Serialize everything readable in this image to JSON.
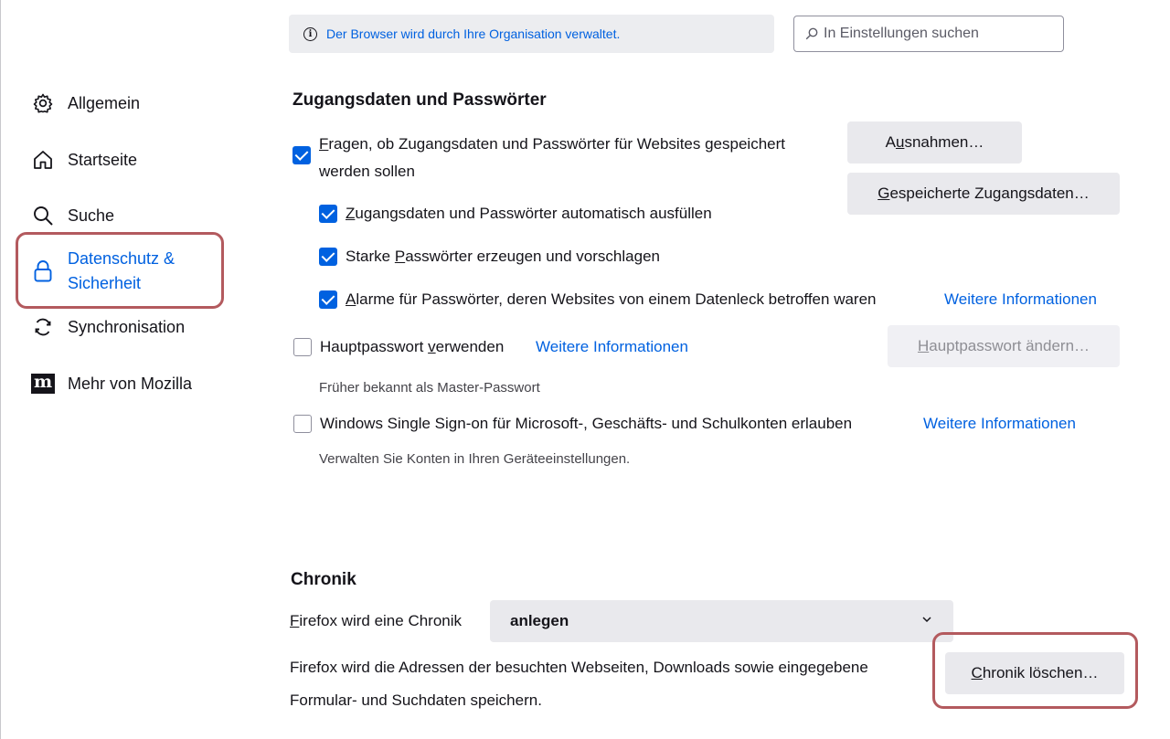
{
  "header": {
    "notice_text": "Der Browser wird durch Ihre Organisation verwaltet.",
    "search_placeholder": "In Einstellungen suchen"
  },
  "sidebar": {
    "items": [
      {
        "label": "Allgemein",
        "icon": "gear-icon"
      },
      {
        "label": "Startseite",
        "icon": "home-icon"
      },
      {
        "label": "Suche",
        "icon": "search-icon"
      },
      {
        "label_line1": "Datenschutz &",
        "label_line2": "Sicherheit",
        "icon": "lock-icon",
        "active": true
      },
      {
        "label": "Synchronisation",
        "icon": "sync-icon"
      },
      {
        "label": "Mehr von Mozilla",
        "icon": "mozilla-icon"
      }
    ]
  },
  "logins": {
    "heading": "Zugangsdaten und Passwörter",
    "ask_save_line1_first": "F",
    "ask_save_line1_rest": "ragen, ob Zugangsdaten und Passwörter für Websites gespeichert",
    "ask_save_line2": "werden sollen",
    "autofill_first": "Z",
    "autofill_rest": "ugangsdaten und Passwörter automatisch ausfüllen",
    "strong_pre": "Starke ",
    "strong_u": "P",
    "strong_post": "asswörter erzeugen und vorschlagen",
    "alerts_first": "A",
    "alerts_rest": "larme für Passwörter, deren Websites von einem Datenleck betroffen waren",
    "alerts_link": "Weitere Informationen",
    "exceptions_pre": "A",
    "exceptions_u": "u",
    "exceptions_post": "snahmen…",
    "saved_first": "G",
    "saved_rest": "espeicherte Zugangsdaten…",
    "primary_pre": "Hauptpasswort ",
    "primary_u": "v",
    "primary_post": "erwenden",
    "primary_link": "Weitere Informationen",
    "primary_note": "Früher bekannt als Master-Passwort",
    "change_primary_first": "H",
    "change_primary_rest": "auptpasswort ändern…",
    "sso_label": "Windows Single Sign-on für Microsoft-, Geschäfts- und Schulkonten erlauben",
    "sso_link": "Weitere Informationen",
    "sso_note": "Verwalten Sie Konten in Ihren Geräteeinstellungen."
  },
  "history": {
    "heading": "Chronik",
    "mode_label_first": "F",
    "mode_label_rest": "irefox wird eine Chronik",
    "mode_value": "anlegen",
    "desc_line1": "Firefox wird die Adressen der besuchten Webseiten, Downloads sowie eingegebene",
    "desc_line2": "Formular- und Suchdaten speichern.",
    "clear_first": "C",
    "clear_rest": "hronik löschen…"
  },
  "colors": {
    "accent": "#0061e0",
    "highlight": "#b35a5e"
  }
}
